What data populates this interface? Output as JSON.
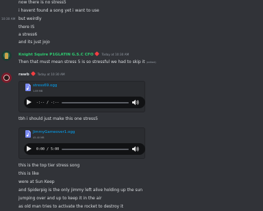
{
  "messages_top": {
    "timestamp": "10:30 AM",
    "lines": [
      "now there is no stress5",
      "i havent found a song yet i want to use",
      "but weirdly",
      "there IS",
      "a stress6",
      "and its just jojo"
    ]
  },
  "message_knight": {
    "username": "Knight Squire P1GLATIN G.S.C CFO",
    "timestamp": "Today at 10:30 AM",
    "text": "Then that must mean stress 5 is so stressful we had to skip it",
    "edited_label": "(edited)",
    "username_color": "#2ecc71"
  },
  "message_rawb": {
    "username": "rawb",
    "timestamp": "Today at 10:30 AM",
    "attachment1": {
      "file_name": "stress69.ogg",
      "file_size": "1.89 MB",
      "time_display": "-:-- / -:--"
    },
    "text1": "tbh i should just make this one stress5",
    "attachment2": {
      "file_name": "JimmyGameover1.ogg",
      "file_size": "45.40 MB",
      "time_display": "0:00 / 5:00"
    },
    "lines": [
      "this is the top tier stress song",
      "this is like",
      "were at Sun Keep",
      "and Spiderpig is the only jimmy left alive holding up the sun",
      "jumping over and up to keep it in the air",
      "as old man tries to activate the rocket to destroy it"
    ]
  },
  "colors": {
    "background": "#313338",
    "text": "#dbdee1",
    "muted": "#949ba4",
    "link": "#00a8fc",
    "badge": "#f23f42"
  },
  "icons": {
    "file": "audio-file-icon",
    "play": "play-icon",
    "volume": "volume-icon",
    "badge": "red-badge-icon"
  }
}
